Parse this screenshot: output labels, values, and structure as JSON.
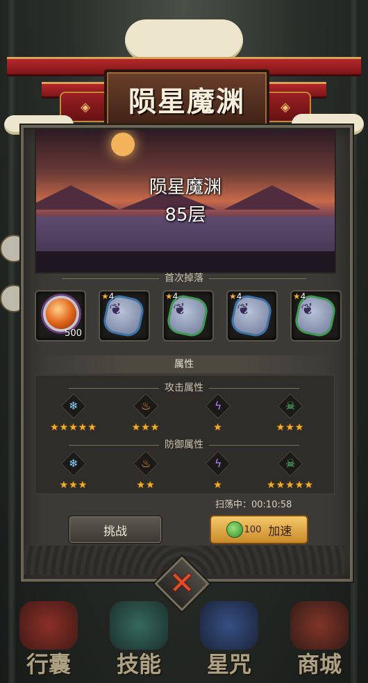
{
  "title_board": "陨星魔渊",
  "scene": {
    "name": "陨星魔渊",
    "floor": "85层"
  },
  "first_drop": {
    "label": "首次掉落",
    "items": [
      {
        "kind": "orb",
        "count": "500"
      },
      {
        "kind": "rune",
        "rim": "blue",
        "star": "4"
      },
      {
        "kind": "rune",
        "rim": "green",
        "star": "4"
      },
      {
        "kind": "rune",
        "rim": "blue",
        "star": "4"
      },
      {
        "kind": "rune",
        "rim": "green",
        "star": "4"
      }
    ]
  },
  "attributes": {
    "label": "属性",
    "attack": {
      "label": "攻击属性",
      "items": [
        {
          "icon": "ice-icon",
          "stars": 5
        },
        {
          "icon": "fire-icon",
          "stars": 3
        },
        {
          "icon": "lightning-icon",
          "stars": 1
        },
        {
          "icon": "skull-icon",
          "stars": 3
        }
      ]
    },
    "defense": {
      "label": "防御属性",
      "items": [
        {
          "icon": "ice-icon",
          "stars": 3
        },
        {
          "icon": "fire-icon",
          "stars": 2
        },
        {
          "icon": "lightning-icon",
          "stars": 1
        },
        {
          "icon": "skull-icon",
          "stars": 5
        }
      ]
    }
  },
  "sweep": "扫荡中：00:10:58",
  "buttons": {
    "challenge": "挑战",
    "speed_cost": "100",
    "speed": "加速"
  },
  "nav": [
    "行囊",
    "技能",
    "星咒",
    "商城"
  ],
  "colors": {
    "gold_button": "#e0a94a",
    "star": "#f2b02a",
    "close_x": "#e24a2a"
  }
}
